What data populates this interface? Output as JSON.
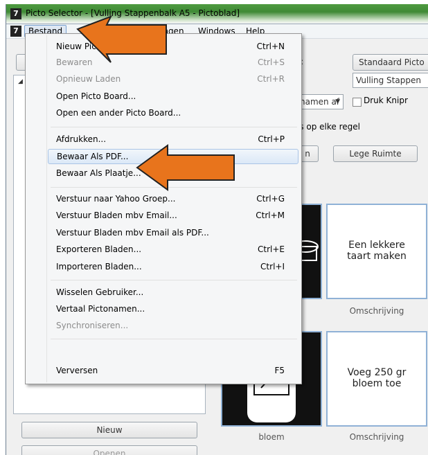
{
  "window": {
    "title": "Picto Selector - [Vulling Stappenbalk A5 - Pictoblad]",
    "app_icon": "picto-selector-app-icon",
    "app_icon_glyph": "7"
  },
  "menubar": {
    "items": [
      {
        "label": "Bestand"
      },
      {
        "label": "ingen"
      },
      {
        "label": "Windows"
      },
      {
        "label": "Help"
      }
    ]
  },
  "file_menu": {
    "groups": [
      [
        {
          "label": "Nieuw Pictoblad",
          "shortcut": "Ctrl+N",
          "enabled": true
        },
        {
          "label": "Bewaren",
          "shortcut": "Ctrl+S",
          "enabled": false
        },
        {
          "label": "Opnieuw Laden",
          "shortcut": "Ctrl+R",
          "enabled": false
        },
        {
          "label": "Open Picto Board...",
          "shortcut": "",
          "enabled": true
        },
        {
          "label": "Open een ander Picto Board...",
          "shortcut": "",
          "enabled": true
        }
      ],
      [
        {
          "label": "Afdrukken...",
          "shortcut": "Ctrl+P",
          "enabled": true
        },
        {
          "label": "Bewaar Als PDF...",
          "shortcut": "",
          "enabled": true,
          "highlighted": true
        },
        {
          "label": "Bewaar Als Plaatje...",
          "shortcut": "",
          "enabled": true
        }
      ],
      [
        {
          "label": "Verstuur naar Yahoo Groep...",
          "shortcut": "Ctrl+G",
          "enabled": true
        },
        {
          "label": "Verstuur Bladen mbv Email...",
          "shortcut": "Ctrl+M",
          "enabled": true
        },
        {
          "label": "Verstuur Bladen mbv Email als PDF...",
          "shortcut": "",
          "enabled": true
        },
        {
          "label": "Exporteren Bladen...",
          "shortcut": "Ctrl+E",
          "enabled": true
        },
        {
          "label": "Importeren Bladen...",
          "shortcut": "Ctrl+I",
          "enabled": true
        }
      ],
      [
        {
          "label": "Wisselen Gebruiker...",
          "shortcut": "",
          "enabled": true
        },
        {
          "label": "Vertaal Pictonamen...",
          "shortcut": "",
          "enabled": true
        },
        {
          "label": "Synchroniseren...",
          "shortcut": "",
          "enabled": false
        }
      ],
      [
        {
          "label": "Verversen",
          "shortcut": "F5",
          "enabled": true
        }
      ]
    ]
  },
  "right_panel": {
    "colon": ":",
    "standard_button": "Standaard Picto",
    "name_field": "Vulling Stappen",
    "names_dropdown": "namen af",
    "print_checkbox_label": "Druk Knipr",
    "per_row_text": "'s op elke regel",
    "small_button": "n",
    "empty_space_button": "Lege Ruimte"
  },
  "cards": [
    {
      "text": "Een lekkere\ntaart maken",
      "caption": "Omschrijving"
    },
    {
      "text": "Voeg 250 gr\nbloem toe",
      "caption": "Omschrijving"
    }
  ],
  "picto_captions": [
    "bloem"
  ],
  "left_panel": {
    "new_button": "Nieuw",
    "open_button": "Openen"
  },
  "colors": {
    "arrow_fill": "#e8741c",
    "arrow_outline": "#222222",
    "highlight": "#dbe8f7",
    "card_border": "#8fb1d6"
  }
}
